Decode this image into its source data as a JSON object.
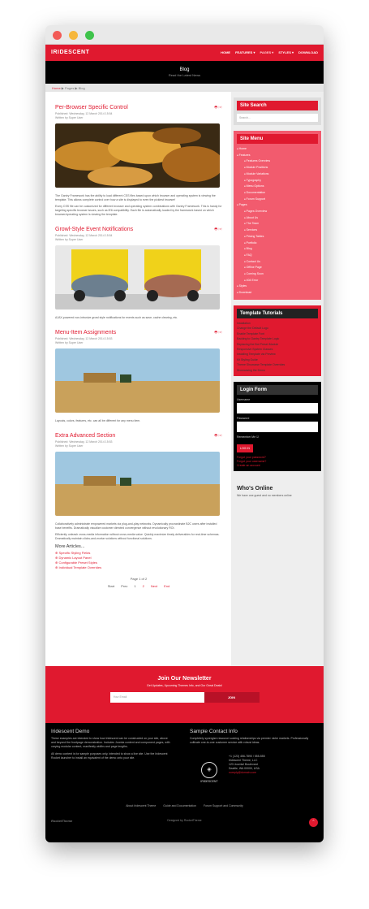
{
  "site": {
    "logo": "IRIDESCENT",
    "menu": [
      "HOME",
      "FEATURES ▾",
      "PAGES ▾",
      "STYLES ▾",
      "DOWNLOAD"
    ],
    "active_menu": 2
  },
  "hero": {
    "title": "Blog",
    "subtitle": "Read the Latest News"
  },
  "breadcrumb": {
    "home": "Home",
    "sep": "▶",
    "pages": "Pages",
    "current": "Blog"
  },
  "posts": [
    {
      "title": "Per-Browser Specific Control",
      "published": "Published: Wednesday, 12 March 2014 15:54",
      "author": "Written by Super User",
      "text": [
        "The Gantry Framework has the ability to load different CSS files based upon which browser and operating system is viewing the template. This allows complete control over how a site is displayed to even the pickiest browser!",
        "Every CSS file can be customized for different browser and operating system combinations with Gantry Framework. This is handy for targeting specific browser issues, such as IE6 compatibility. Each file is automatically loaded by the framework based on which browser/operating system is viewing the template."
      ]
    },
    {
      "title": "Growl-Style Event Notifications",
      "published": "Published: Wednesday, 12 March 2014 15:54",
      "author": "Written by Super User",
      "text": [
        "AJAX-powered non-intrusive growl style notifications for events such as save, cache clearing, etc."
      ]
    },
    {
      "title": "Menu-Item Assignments",
      "published": "Published: Wednesday, 12 March 2014 15:53",
      "author": "Written by Super User",
      "text": [
        "Layouts, colors, features, etc. can all be different for any menu item."
      ]
    },
    {
      "title": "Extra Advanced Section",
      "published": "Published: Wednesday, 12 March 2014 15:53",
      "author": "Written by Super User",
      "text": [
        "Collaboratively administrate empowered markets via plug-and-play networks. Dynamically procrastinate B2C users after installed base benefits. Dramatically visualize customer directed convergence without revolutionary ROI.",
        "Efficiently unleash cross-media information without cross-media value. Quickly maximize timely deliverables for real-time schemas. Dramatically maintain clicks-and-mortar solutions without functional solutions."
      ]
    }
  ],
  "more": {
    "title": "More Articles...",
    "items": [
      "Specific Styling Fields",
      "Dynamic Layout Panel",
      "Configurable Preset Styles",
      "Individual Template Overrides"
    ]
  },
  "pager": {
    "counter": "Page 1 of 2",
    "start": "Start",
    "prev": "Prev",
    "p1": "1",
    "p2": "2",
    "next": "Next",
    "end": "End"
  },
  "sidebar": {
    "search": {
      "title": "Site Search",
      "placeholder": "Search..."
    },
    "menu": {
      "title": "Site Menu",
      "items": [
        {
          "label": "Home",
          "sub": false
        },
        {
          "label": "Features",
          "sub": false
        },
        {
          "label": "Features Overview",
          "sub": true
        },
        {
          "label": "Module Positions",
          "sub": true
        },
        {
          "label": "Module Variations",
          "sub": true
        },
        {
          "label": "Typography",
          "sub": true
        },
        {
          "label": "Menu Options",
          "sub": true
        },
        {
          "label": "Documentation",
          "sub": true
        },
        {
          "label": "Forum Support",
          "sub": true
        },
        {
          "label": "Pages",
          "sub": false
        },
        {
          "label": "Pages Overview",
          "sub": true
        },
        {
          "label": "About Us",
          "sub": true
        },
        {
          "label": "The Team",
          "sub": true
        },
        {
          "label": "Services",
          "sub": true
        },
        {
          "label": "Pricing Tables",
          "sub": true
        },
        {
          "label": "Portfolio",
          "sub": true
        },
        {
          "label": "Blog",
          "sub": true
        },
        {
          "label": "FAQ",
          "sub": true
        },
        {
          "label": "Contact Us",
          "sub": true
        },
        {
          "label": "Offline Page",
          "sub": true
        },
        {
          "label": "Coming Soon",
          "sub": true
        },
        {
          "label": "404 Error",
          "sub": true
        },
        {
          "label": "Styles",
          "sub": false
        },
        {
          "label": "Download",
          "sub": false
        }
      ]
    },
    "tutorials": {
      "title": "Template Tutorials",
      "items": [
        "Installation",
        "Change the Default Logo",
        "Enable Template Font",
        "Backing to Gantry Template Logic",
        "Replacing the Bot Preset Module",
        "Responsive System Classes",
        "Installing Template via Preview",
        "Kit Styling Guide",
        "Theme Showcase Template Overrides",
        "Showcasing the Demo"
      ]
    },
    "login": {
      "title": "Login Form",
      "username": "Username",
      "password": "Password",
      "remember": "Remember Me",
      "button": "LOG IN",
      "links": [
        "Forgot your password?",
        "Forgot your username?",
        "Create an account"
      ]
    },
    "online": {
      "title": "Who's Online",
      "text": "We have one guest and no members online"
    }
  },
  "newsletter": {
    "title": "Join Our Newsletter",
    "subtitle": "Get Updates, Upcoming Themes Info, and Our Great Deals!",
    "placeholder": "Your Email",
    "button": "JOIN"
  },
  "footer": {
    "demo": {
      "title": "Iridescent Demo",
      "p1": "These examples are intended to show how Iridescent can be constructed on your site, above and beyond the frontpage demonstration. Includes Joomla content and component pages, with varying modular content, manifestly widths and page lengths.",
      "p2": "All demo content is for sample purposes only, intended to show a live site. Use the Iridescent Rocket launcher to install an equivalent of the demo onto your site."
    },
    "contact": {
      "title": "Sample Contact Info",
      "p1": "Completely synergize resource sucking relationships via premier niche markets. Professionally cultivate one-to-one customer service with robust ideas.",
      "lines": [
        "+1 (123) 456-7890 / 555-555",
        "Iridescent Theme, LLC",
        "123 Joomla! Boulevard",
        "Seattle, WA 00000, USA",
        "noreply@domain.com"
      ]
    },
    "logo_text": "IRIDESCENT",
    "links": [
      "About Iridescent Theme",
      "Guide and Documentation",
      "Forum Support and Community"
    ],
    "credit": "Designed by RocketTheme",
    "brand": "RocketTheme",
    "top": "⌃"
  },
  "colors": {
    "accent": "#e0192f",
    "dark": "#000000"
  }
}
